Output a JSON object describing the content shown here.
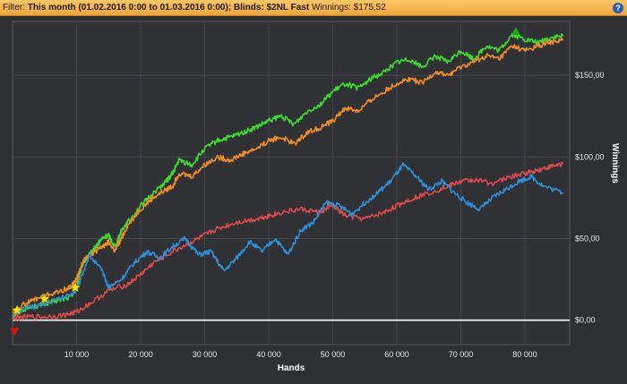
{
  "filter": {
    "prefix": "Filter:",
    "period": "This month (01.02.2016 0:00 to 01.03.2016 0:00);",
    "blinds": "Blinds: $2NL Fast",
    "winnings": "Winnings: $175,52",
    "help_icon": "question-icon"
  },
  "colors": {
    "background": "#2e3033",
    "plot_background": "#303236",
    "grid": "#45484d",
    "zero_line": "#ffffff",
    "series_green": "#3ddc2e",
    "series_orange": "#f28c28",
    "series_red": "#e04a4a",
    "series_blue": "#2f8fd8",
    "star_marker": "#f5e21a",
    "peak_marker": "#1ea51a",
    "low_marker": "#e01010"
  },
  "chart_data": {
    "type": "line",
    "title": "",
    "xlabel": "Hands",
    "ylabel": "Winnings",
    "xlim": [
      0,
      87000
    ],
    "ylim": [
      -15,
      183
    ],
    "grid": true,
    "legend": "none",
    "x_ticks": [
      10000,
      20000,
      30000,
      40000,
      50000,
      60000,
      70000,
      80000
    ],
    "x_tick_labels": [
      "10 000",
      "20 000",
      "30 000",
      "40 000",
      "50 000",
      "60 000",
      "70 000",
      "80 000"
    ],
    "y_ticks": [
      0,
      50,
      100,
      150
    ],
    "y_tick_labels": [
      "$0,00",
      "$50,00",
      "$100,00",
      "$150,00"
    ],
    "series": [
      {
        "color": "#3ddc2e",
        "x": [
          0,
          1000,
          3000,
          5000,
          7000,
          9000,
          10000,
          11000,
          12000,
          13000,
          14000,
          15000,
          16000,
          17000,
          18000,
          20000,
          22000,
          24000,
          25000,
          26000,
          28000,
          30000,
          32000,
          34000,
          36000,
          38000,
          40000,
          42000,
          44000,
          46000,
          48000,
          50000,
          52000,
          54000,
          56000,
          58000,
          60000,
          62000,
          64000,
          66000,
          68000,
          70000,
          72000,
          74000,
          76000,
          78000,
          80000,
          82000,
          84000,
          86000
        ],
        "y": [
          2,
          6,
          8,
          10,
          12,
          14,
          20,
          35,
          40,
          45,
          50,
          52,
          45,
          55,
          60,
          70,
          78,
          85,
          90,
          98,
          95,
          105,
          110,
          112,
          115,
          118,
          122,
          125,
          120,
          128,
          132,
          140,
          145,
          142,
          148,
          152,
          158,
          160,
          155,
          162,
          158,
          165,
          160,
          168,
          165,
          175,
          172,
          170,
          173,
          174
        ]
      },
      {
        "color": "#f28c28",
        "x": [
          0,
          1000,
          3000,
          5000,
          7000,
          9000,
          10000,
          11000,
          12000,
          13000,
          14000,
          15000,
          16000,
          17000,
          18000,
          20000,
          22000,
          24000,
          25000,
          26000,
          28000,
          30000,
          32000,
          34000,
          36000,
          38000,
          40000,
          42000,
          44000,
          46000,
          48000,
          50000,
          52000,
          54000,
          56000,
          58000,
          60000,
          62000,
          64000,
          66000,
          68000,
          70000,
          72000,
          74000,
          76000,
          78000,
          80000,
          82000,
          84000,
          86000
        ],
        "y": [
          3,
          8,
          12,
          15,
          17,
          20,
          25,
          36,
          40,
          42,
          45,
          48,
          42,
          50,
          58,
          68,
          75,
          80,
          82,
          90,
          88,
          95,
          100,
          98,
          102,
          105,
          110,
          112,
          108,
          115,
          118,
          122,
          130,
          128,
          135,
          140,
          145,
          148,
          145,
          152,
          150,
          155,
          158,
          162,
          160,
          168,
          165,
          168,
          170,
          172
        ]
      },
      {
        "color": "#e04a4a",
        "x": [
          0,
          2000,
          5000,
          8000,
          10000,
          12000,
          15000,
          18000,
          20000,
          22000,
          25000,
          28000,
          30000,
          32000,
          35000,
          38000,
          40000,
          42000,
          45000,
          48000,
          50000,
          52000,
          55000,
          58000,
          60000,
          62000,
          65000,
          68000,
          70000,
          72000,
          75000,
          78000,
          80000,
          82000,
          84000,
          86000
        ],
        "y": [
          1,
          2,
          2,
          3,
          5,
          10,
          18,
          22,
          28,
          35,
          42,
          48,
          52,
          56,
          60,
          62,
          64,
          66,
          68,
          66,
          70,
          64,
          62,
          66,
          70,
          74,
          78,
          82,
          85,
          86,
          84,
          88,
          90,
          92,
          94,
          96
        ]
      },
      {
        "color": "#2f8fd8",
        "x": [
          0,
          2000,
          5000,
          8000,
          10000,
          12000,
          14000,
          15000,
          17000,
          19000,
          21000,
          23000,
          25000,
          27000,
          29000,
          31000,
          33000,
          35000,
          37000,
          39000,
          41000,
          43000,
          45000,
          47000,
          49000,
          51000,
          53000,
          55000,
          57000,
          59000,
          61000,
          63000,
          65000,
          67000,
          69000,
          71000,
          73000,
          75000,
          77000,
          79000,
          81000,
          83000,
          86000
        ],
        "y": [
          3,
          7,
          10,
          14,
          18,
          40,
          30,
          20,
          25,
          35,
          42,
          38,
          45,
          50,
          40,
          42,
          30,
          38,
          48,
          42,
          50,
          40,
          55,
          60,
          72,
          70,
          65,
          72,
          78,
          85,
          95,
          88,
          80,
          85,
          78,
          72,
          68,
          75,
          80,
          85,
          88,
          82,
          78
        ]
      }
    ],
    "markers": [
      {
        "type": "star",
        "x": 700,
        "y": 6
      },
      {
        "type": "star",
        "x": 5000,
        "y": 13
      },
      {
        "type": "star",
        "x": 9800,
        "y": 20
      },
      {
        "type": "peak",
        "x": 78600,
        "y": 177
      },
      {
        "type": "low",
        "x": 300,
        "y": -7
      }
    ]
  }
}
